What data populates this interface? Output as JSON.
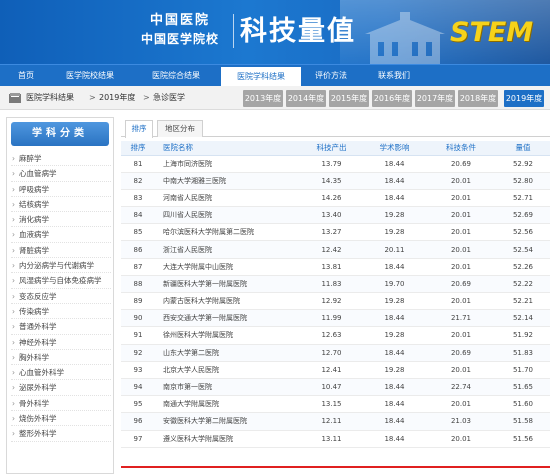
{
  "banner": {
    "logo_line1": "中国医院",
    "logo_line2": "中国医学院校",
    "title": "科技量值",
    "stem": "STEM"
  },
  "nav": {
    "items": [
      "首页",
      "医学院校结果",
      "医院综合结果",
      "医院学科结果",
      "评价方法",
      "联系我们"
    ],
    "active_index": 3
  },
  "breadcrumb": {
    "items": [
      "医院学科结果",
      "2019年度",
      "急诊医学"
    ],
    "separator": ">"
  },
  "years": [
    "2013年度",
    "2014年度",
    "2015年度",
    "2016年度",
    "2017年度",
    "2018年度",
    "2019年度"
  ],
  "active_year": "2019年度",
  "sidebar": {
    "title": "学科分类",
    "items": [
      "麻醉学",
      "心血管病学",
      "呼吸病学",
      "结核病学",
      "消化病学",
      "血液病学",
      "肾脏病学",
      "内分泌病学与代谢病学",
      "风湿病学与自体免疫病学",
      "变态反应学",
      "传染病学",
      "普通外科学",
      "神经外科学",
      "胸外科学",
      "心血管外科学",
      "泌尿外科学",
      "骨外科学",
      "烧伤外科学",
      "整形外科学"
    ]
  },
  "tabs": [
    "排序",
    "地区分布"
  ],
  "table": {
    "headers": [
      "排序",
      "医院名称",
      "科技产出",
      "学术影响",
      "科技条件",
      "量值"
    ],
    "rows": [
      [
        "81",
        "上海市同济医院",
        "13.79",
        "18.44",
        "20.69",
        "52.92"
      ],
      [
        "82",
        "中南大学湘雅三医院",
        "14.35",
        "18.44",
        "20.01",
        "52.80"
      ],
      [
        "83",
        "河南省人民医院",
        "14.26",
        "18.44",
        "20.01",
        "52.71"
      ],
      [
        "84",
        "四川省人民医院",
        "13.40",
        "19.28",
        "20.01",
        "52.69"
      ],
      [
        "85",
        "哈尔滨医科大学附属第二医院",
        "13.27",
        "19.28",
        "20.01",
        "52.56"
      ],
      [
        "86",
        "浙江省人民医院",
        "12.42",
        "20.11",
        "20.01",
        "52.54"
      ],
      [
        "87",
        "大连大学附属中山医院",
        "13.81",
        "18.44",
        "20.01",
        "52.26"
      ],
      [
        "88",
        "新疆医科大学第一附属医院",
        "11.83",
        "19.70",
        "20.69",
        "52.22"
      ],
      [
        "89",
        "内蒙古医科大学附属医院",
        "12.92",
        "19.28",
        "20.01",
        "52.21"
      ],
      [
        "90",
        "西安交通大学第一附属医院",
        "11.99",
        "18.44",
        "21.71",
        "52.14"
      ],
      [
        "91",
        "徐州医科大学附属医院",
        "12.63",
        "19.28",
        "20.01",
        "51.92"
      ],
      [
        "92",
        "山东大学第二医院",
        "12.70",
        "18.44",
        "20.69",
        "51.83"
      ],
      [
        "93",
        "北京大学人民医院",
        "12.41",
        "19.28",
        "20.01",
        "51.70"
      ],
      [
        "94",
        "南京市第一医院",
        "10.47",
        "18.44",
        "22.74",
        "51.65"
      ],
      [
        "95",
        "南通大学附属医院",
        "13.15",
        "18.44",
        "20.01",
        "51.60"
      ],
      [
        "96",
        "安徽医科大学第二附属医院",
        "12.11",
        "18.44",
        "21.03",
        "51.58"
      ],
      [
        "97",
        "遵义医科大学附属医院",
        "13.11",
        "18.44",
        "20.01",
        "51.56"
      ]
    ]
  },
  "colors": {
    "brand_blue": "#1d6fc6",
    "stem_yellow": "#f6d21a",
    "inactive_year": "#a5a5a5",
    "highlight_line": "#e02020"
  }
}
